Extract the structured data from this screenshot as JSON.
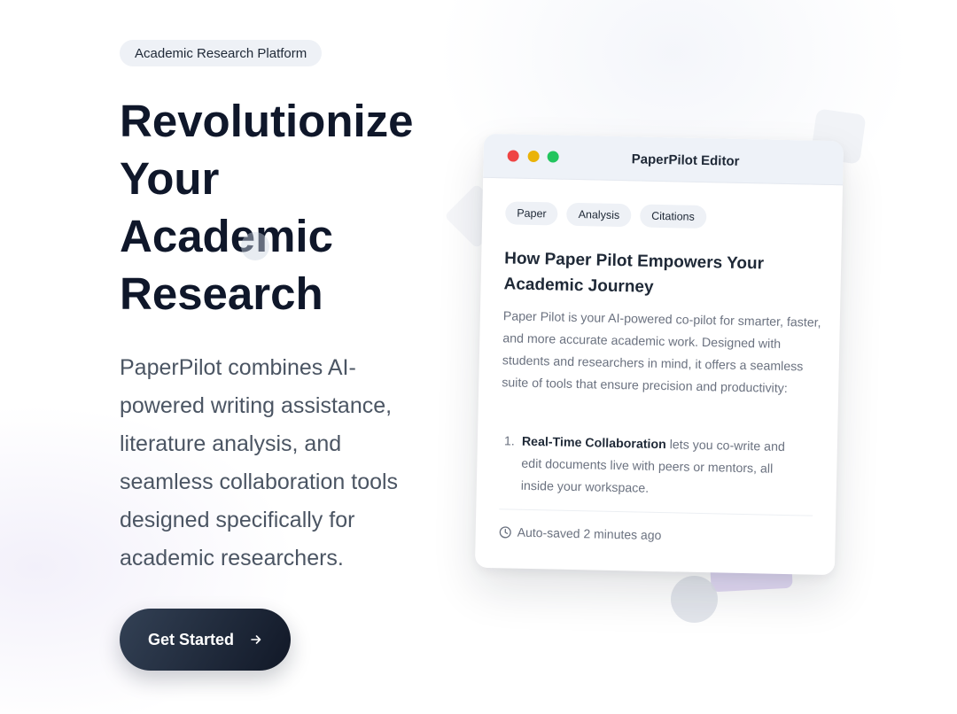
{
  "hero": {
    "badge": "Academic Research Platform",
    "headline": [
      "Revolutionize",
      "Your",
      "Academic",
      "Research"
    ],
    "description": "PaperPilot combines AI-powered writing assistance, literature analysis, and seamless collaboration tools designed specifically for academic researchers.",
    "cta": {
      "label": "Get Started",
      "icon": "arrow-right-icon"
    }
  },
  "editor": {
    "window_title": "PaperPilot Editor",
    "window_controls": [
      "close",
      "minimize",
      "maximize"
    ],
    "tags": [
      "Paper",
      "Analysis",
      "Citations"
    ],
    "doc_title": "How Paper Pilot Empowers Your Academic Journey",
    "doc_body": "Paper Pilot is your AI-powered co-pilot for smarter, faster, and more accurate academic work. Designed with students and researchers in mind, it offers a seamless suite of tools that ensure precision and productivity:",
    "list": [
      {
        "number": "1.",
        "strong": "Real-Time Collaboration",
        "text": " lets you co-write and edit documents live with peers or mentors, all inside your workspace."
      }
    ],
    "status": {
      "icon": "clock-icon",
      "text": "Auto-saved 2 minutes ago"
    }
  },
  "colors": {
    "heading": "#0f172a",
    "body_text": "#4b5563",
    "badge_bg": "#eef1f6",
    "cta_gradient_start": "#334155",
    "cta_gradient_end": "#111827",
    "dot_red": "#ef4444",
    "dot_yellow": "#eab308",
    "dot_green": "#22c55e"
  }
}
